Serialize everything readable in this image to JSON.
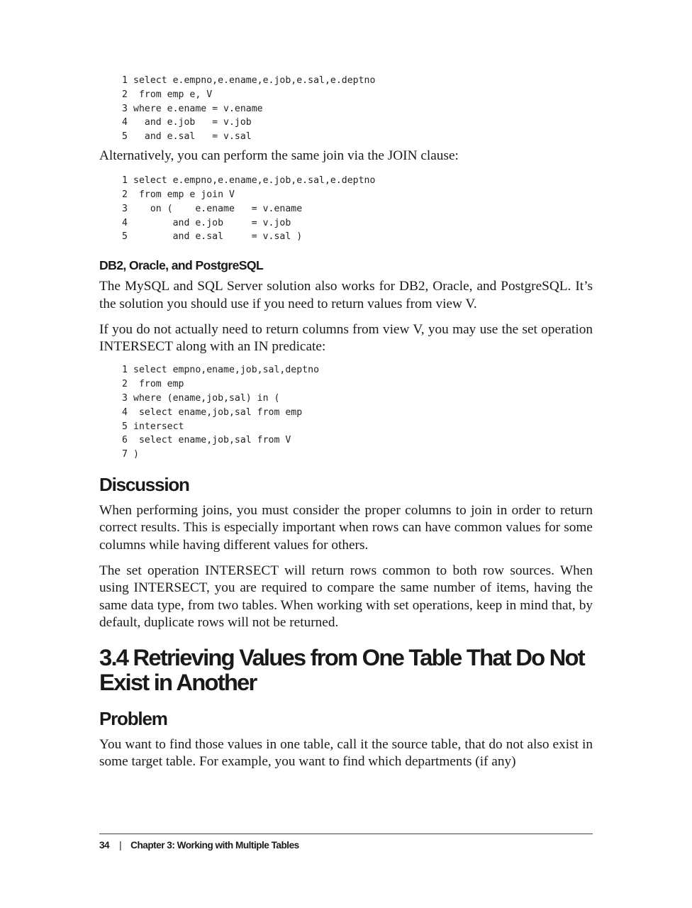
{
  "code_block_1": [
    {
      "n": "1",
      "code": "select e.empno,e.ename,e.job,e.sal,e.deptno"
    },
    {
      "n": "2",
      "code": " from emp e, V"
    },
    {
      "n": "3",
      "code": "where e.ename = v.ename"
    },
    {
      "n": "4",
      "code": "  and e.job   = v.job"
    },
    {
      "n": "5",
      "code": "  and e.sal   = v.sal"
    }
  ],
  "para_join_clause": "Alternatively, you can perform the same join via the JOIN clause:",
  "code_block_2": [
    {
      "n": "1",
      "code": "select e.empno,e.ename,e.job,e.sal,e.deptno"
    },
    {
      "n": "2",
      "code": " from emp e join V"
    },
    {
      "n": "3",
      "code": "   on (    e.ename   = v.ename"
    },
    {
      "n": "4",
      "code": "       and e.job     = v.job"
    },
    {
      "n": "5",
      "code": "       and e.sal     = v.sal )"
    }
  ],
  "heading_db2": "DB2, Oracle, and PostgreSQL",
  "para_db2_1": "The MySQL and SQL Server solution also works for DB2, Oracle, and PostgreSQL. It’s the solution you should use if you need to return values from view V.",
  "para_db2_2": "If you do not actually need to return columns from view V, you may use the set operation INTERSECT along with an IN predicate:",
  "code_block_3": [
    {
      "n": "1",
      "code": "select empno,ename,job,sal,deptno"
    },
    {
      "n": "2",
      "code": " from emp"
    },
    {
      "n": "3",
      "code": "where (ename,job,sal) in ("
    },
    {
      "n": "4",
      "code": " select ename,job,sal from emp"
    },
    {
      "n": "5",
      "code": "intersect"
    },
    {
      "n": "6",
      "code": " select ename,job,sal from V"
    },
    {
      "n": "7",
      "code": ")"
    }
  ],
  "heading_discussion": "Discussion",
  "para_discussion_1": "When performing joins, you must consider the proper columns to join in order to return correct results. This is especially important when rows can have common values for some columns while having different values for others.",
  "para_discussion_2": "The set operation INTERSECT will return rows common to both row sources. When using INTERSECT, you are required to compare the same number of items, having the same data type, from two tables. When working with set operations, keep in mind that, by default, duplicate rows will not be returned.",
  "heading_recipe": "3.4 Retrieving Values from One Table That Do Not Exist in Another",
  "heading_problem": "Problem",
  "para_problem": "You want to find those values in one table, call it the source table, that do not also exist in some target table. For example, you want to find which departments (if any)",
  "footer": {
    "page_number": "34",
    "separator": "|",
    "chapter_title": "Chapter 3: Working with Multiple Tables"
  }
}
